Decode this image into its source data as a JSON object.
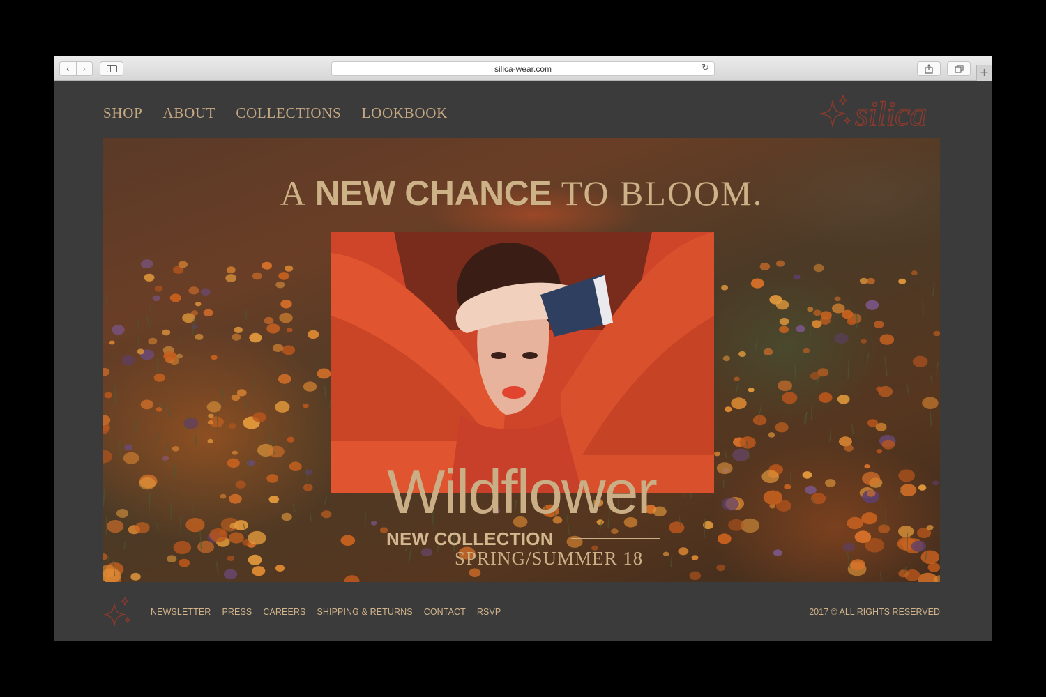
{
  "browser": {
    "url": "silica-wear.com",
    "icons": {
      "back": "chevron-left-icon",
      "forward": "chevron-right-icon",
      "sidebar": "sidebar-icon",
      "reload": "reload-icon",
      "share": "share-icon",
      "tabs": "tabs-overview-icon",
      "new_tab": "plus-icon"
    }
  },
  "nav": {
    "items": [
      "SHOP",
      "ABOUT",
      "COLLECTIONS",
      "LOOKBOOK"
    ]
  },
  "logo": {
    "text": "silica",
    "icon": "sparkle-icon",
    "color": "#8a3a2c"
  },
  "hero": {
    "headline_lead": "A ",
    "headline_bold": "NEW CHANCE",
    "headline_tail": " TO BLOOM.",
    "collection_name": "Wildflower",
    "collection_label": "NEW COLLECTION",
    "season": "SPRING/SUMMER 18"
  },
  "footer": {
    "links": [
      "NEWSLETTER",
      "PRESS",
      "CAREERS",
      "SHIPPING & RETURNS",
      "CONTACT",
      "RSVP"
    ],
    "copyright": "2017 © ALL RIGHTS RESERVED",
    "icon": "sparkle-icon"
  },
  "colors": {
    "accent_gold": "#c6a882",
    "background": "#3b3b3b",
    "logo_red": "#8a3a2c",
    "photo_red": "#d2462b"
  }
}
